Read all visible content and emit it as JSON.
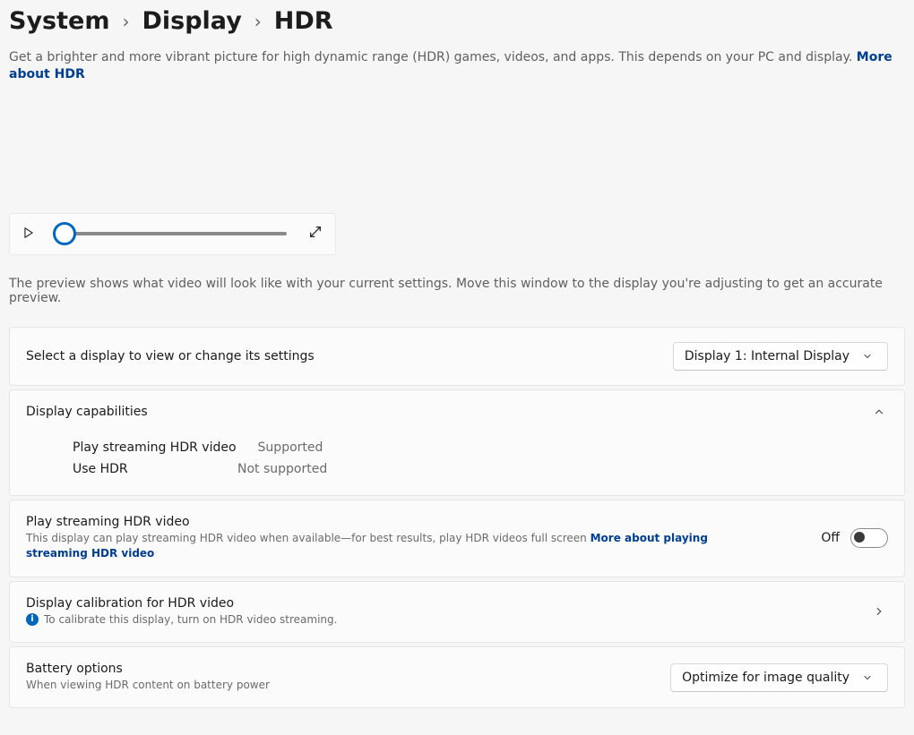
{
  "breadcrumb": {
    "item1": "System",
    "item2": "Display",
    "item3": "HDR"
  },
  "lead_text": "Get a brighter and more vibrant picture for high dynamic range (HDR) games, videos, and apps. This depends on your PC and display. ",
  "lead_link": "More about HDR",
  "preview": {
    "note": "The preview shows what video will look like with your current settings. Move this window to the display you're adjusting to get an accurate preview."
  },
  "display_select": {
    "label": "Select a display to view or change its settings",
    "value": "Display 1: Internal Display"
  },
  "capabilities": {
    "header": "Display capabilities",
    "rows": [
      {
        "label": "Play streaming HDR video",
        "value": "Supported"
      },
      {
        "label": "Use HDR",
        "value": "Not supported"
      }
    ]
  },
  "stream_hdr": {
    "title": "Play streaming HDR video",
    "desc": "This display can play streaming HDR video when available—for best results, play HDR videos full screen  ",
    "desc_link": "More about playing streaming HDR video",
    "state": "Off"
  },
  "calibration": {
    "title": "Display calibration for HDR video",
    "note": "To calibrate this display, turn on HDR video streaming."
  },
  "battery": {
    "title": "Battery options",
    "sub": "When viewing HDR content on battery power",
    "value": "Optimize for image quality"
  }
}
